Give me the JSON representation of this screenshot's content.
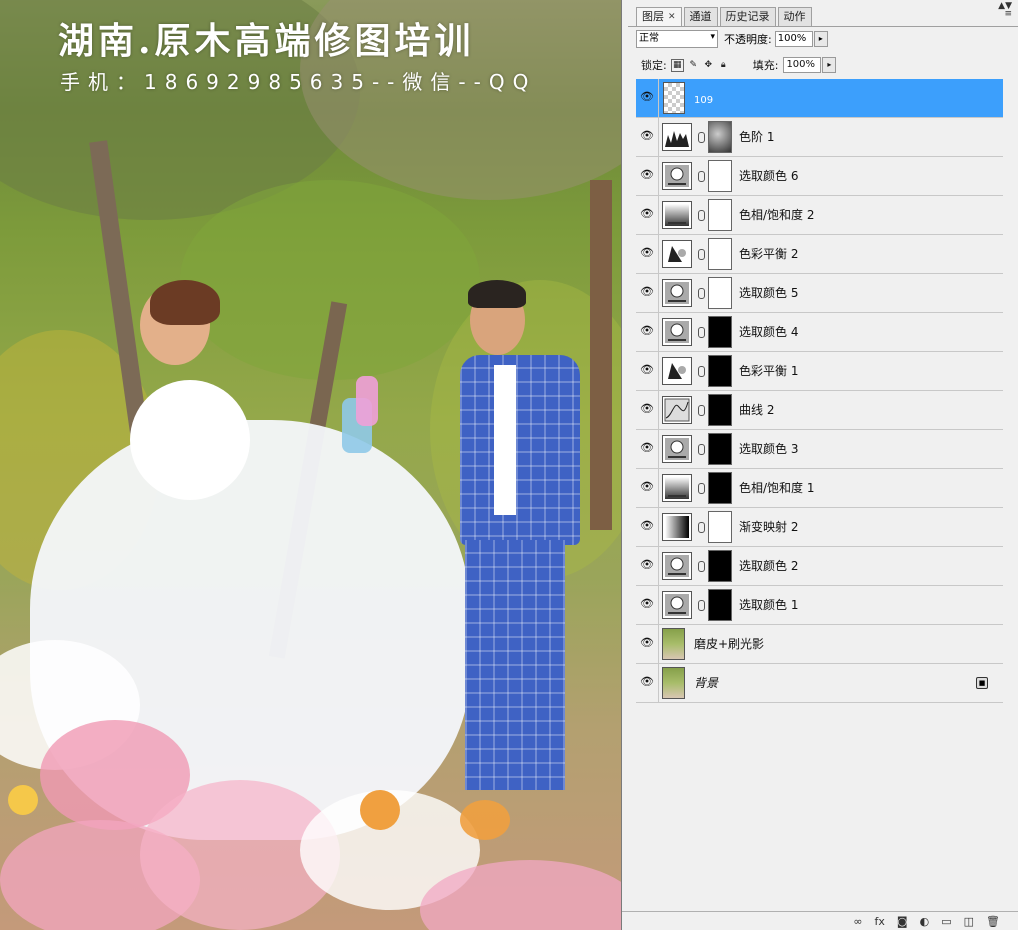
{
  "watermark": {
    "line1": "湖南.原木高端修图培训",
    "line2": "手机：18692985635--微信--QQ"
  },
  "panel": {
    "tabs": [
      {
        "label": "图层",
        "closable": true
      },
      {
        "label": "通道",
        "closable": false
      },
      {
        "label": "历史记录",
        "closable": false
      },
      {
        "label": "动作",
        "closable": false
      }
    ],
    "blend_mode": "正常",
    "opacity_label": "不透明度:",
    "opacity_value": "100%",
    "lock_label": "锁定:",
    "fill_label": "填充:",
    "fill_value": "100%",
    "layers": [
      {
        "name": "109",
        "type": "pixel-empty",
        "selected": true
      },
      {
        "name": "色阶 1",
        "type": "levels",
        "mask": "photo"
      },
      {
        "name": "选取颜色 6",
        "type": "selective",
        "mask": "white"
      },
      {
        "name": "色相/饱和度 2",
        "type": "hue",
        "mask": "white"
      },
      {
        "name": "色彩平衡 2",
        "type": "balance",
        "mask": "white"
      },
      {
        "name": "选取颜色 5",
        "type": "selective",
        "mask": "white"
      },
      {
        "name": "选取颜色 4",
        "type": "selective",
        "mask": "black"
      },
      {
        "name": "色彩平衡 1",
        "type": "balance",
        "mask": "black"
      },
      {
        "name": "曲线 2",
        "type": "curves",
        "mask": "black"
      },
      {
        "name": "选取颜色 3",
        "type": "selective",
        "mask": "black"
      },
      {
        "name": "色相/饱和度 1",
        "type": "hue",
        "mask": "black"
      },
      {
        "name": "渐变映射 2",
        "type": "gradient",
        "mask": "white"
      },
      {
        "name": "选取颜色 2",
        "type": "selective",
        "mask": "black"
      },
      {
        "name": "选取颜色 1",
        "type": "selective",
        "mask": "black"
      },
      {
        "name": "磨皮+刷光影",
        "type": "pixel"
      },
      {
        "name": "背景",
        "type": "background",
        "locked": true
      }
    ],
    "footer_icons": [
      "link-icon",
      "fx-icon",
      "add-mask-icon",
      "adjustment-icon",
      "group-icon",
      "new-layer-icon",
      "trash-icon"
    ]
  },
  "colors": {
    "selection": "#3c9ffc"
  }
}
